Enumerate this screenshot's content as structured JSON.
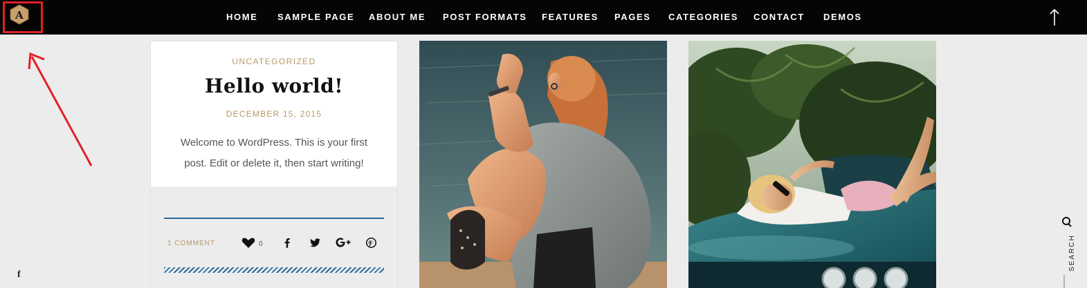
{
  "nav": {
    "logo_letter": "A",
    "items": [
      {
        "label": "HOME"
      },
      {
        "label": "SAMPLE PAGE"
      },
      {
        "label": "ABOUT ME"
      },
      {
        "label": "POST FORMATS"
      },
      {
        "label": "FEATURES"
      },
      {
        "label": "PAGES"
      },
      {
        "label": "CATEGORIES"
      },
      {
        "label": "CONTACT"
      },
      {
        "label": "DEMOS"
      }
    ]
  },
  "post": {
    "category": "UNCATEGORIZED",
    "title": "Hello world!",
    "date": "DECEMBER 15, 2015",
    "excerpt": "Welcome to WordPress. This is your first post. Edit or delete it, then start writing!",
    "comments": "1 COMMENT",
    "likes": "0"
  },
  "share_icons": [
    "facebook-icon",
    "twitter-icon",
    "google-plus-icon",
    "pinterest-icon"
  ],
  "sidebar_right": {
    "search_label": "SEARCH"
  },
  "sidebar_left": {
    "social_glyph": "f"
  },
  "colors": {
    "topbar": "#050505",
    "accent_gold": "#b79865",
    "accent_blue": "#2a6a9e",
    "annotation_red": "#e1202a",
    "background": "#ececec"
  }
}
